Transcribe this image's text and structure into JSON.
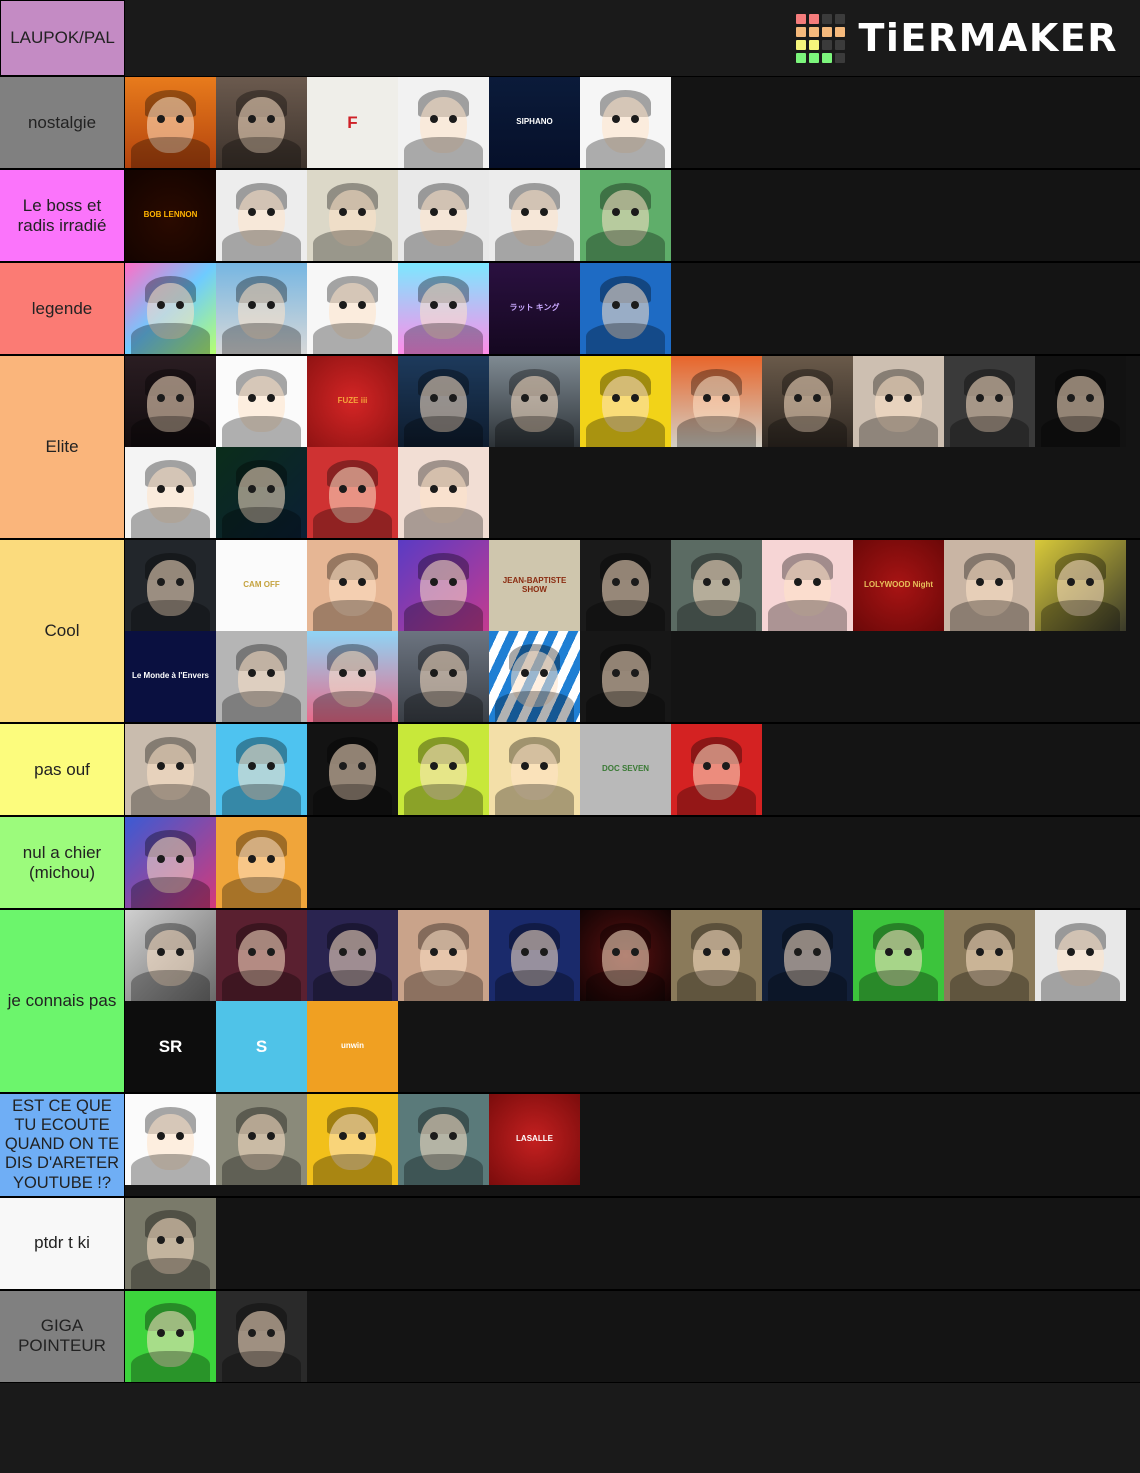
{
  "header": {
    "title": "LAUPOK/PAL",
    "title_color": "#C48BC4",
    "brand": "TiERMAKER",
    "brand_swatches": [
      "#F57C7C",
      "#F57C7C",
      "#3b3b3b",
      "#3b3b3b",
      "#F5B97C",
      "#F5B97C",
      "#F5B97C",
      "#F5B97C",
      "#F5F57C",
      "#F5F57C",
      "#3b3b3b",
      "#3b3b3b",
      "#7CF57C",
      "#7CF57C",
      "#7CF57C",
      "#3b3b3b"
    ]
  },
  "tiers": [
    {
      "label": "nostalgie",
      "color": "#808080",
      "items": [
        {
          "name": "minecraft-duo-animation",
          "text": "",
          "bg": "linear-gradient(180deg,#e87b1c,#b3430d)",
          "fg": "#fff"
        },
        {
          "name": "curly-hair-youtuber",
          "text": "",
          "bg": "linear-gradient(180deg,#6b5a4e,#3d332c)",
          "fg": "#fff"
        },
        {
          "name": "red-black-f-logo",
          "text": "F",
          "bg": "#efeee9",
          "fg": "#cf2027",
          "size": "big"
        },
        {
          "name": "shocked-youtuber-hands-head",
          "text": "",
          "bg": "#f2f2f2",
          "fg": "#111"
        },
        {
          "name": "siphano-logo",
          "text": "SIPHANO",
          "bg": "linear-gradient(180deg,#0b1b3a,#06102a)",
          "fg": "#ffffff",
          "size": "tiny"
        },
        {
          "name": "green-shirt-youtuber",
          "text": "",
          "bg": "#f6f6f6",
          "fg": "#111"
        }
      ]
    },
    {
      "label": "Le boss et radis irradié",
      "color": "#FB74FB",
      "items": [
        {
          "name": "bob-lennon-logo",
          "text": "BOB LENNON",
          "bg": "radial-gradient(circle at 50% 55%,#2a0a00,#120300)",
          "fg": "#ffb300",
          "size": "tiny"
        },
        {
          "name": "surprised-man-grey-jacket",
          "text": "",
          "bg": "#ededed",
          "fg": "#111"
        },
        {
          "name": "bearded-man-yellow-shirt",
          "text": "",
          "bg": "#dcd8c8",
          "fg": "#111"
        },
        {
          "name": "man-with-glasses-beard",
          "text": "",
          "bg": "#e9e9e9",
          "fg": "#111"
        },
        {
          "name": "two-friends-red-shirts",
          "text": "",
          "bg": "#ececec",
          "fg": "#111"
        },
        {
          "name": "cat-cartoon-green-bg",
          "text": "",
          "bg": "#5fae6a",
          "fg": "#fff"
        }
      ]
    },
    {
      "label": "legende",
      "color": "#FB7B74",
      "items": [
        {
          "name": "white-egg-character-rainbow",
          "text": "",
          "bg": "linear-gradient(135deg,#ff6ec7,#6ecbff,#b6ff6e)",
          "fg": "#222"
        },
        {
          "name": "blond-man-striped-shirt",
          "text": "",
          "bg": "linear-gradient(180deg,#76b6e2,#d8d8d8)",
          "fg": "#111"
        },
        {
          "name": "anime-straw-hat-character",
          "text": "",
          "bg": "#f7f7f7",
          "fg": "#111"
        },
        {
          "name": "potato-character",
          "text": "",
          "bg": "linear-gradient(180deg,#7ce8ff,#ff8ce8)",
          "fg": "#6b4a2a"
        },
        {
          "name": "rat-king-purple-avatar",
          "text": "ラット キング",
          "bg": "linear-gradient(180deg,#2a1040,#150820)",
          "fg": "#c9a8ff",
          "size": "tiny"
        },
        {
          "name": "banana-blue-bg",
          "text": "",
          "bg": "#1e6bc4",
          "fg": "#f5d742"
        }
      ]
    },
    {
      "label": "Elite",
      "color": "#FAB57B",
      "items": [
        {
          "name": "man-dark-stage",
          "text": "",
          "bg": "linear-gradient(180deg,#2a1d22,#120c0e)",
          "fg": "#fff"
        },
        {
          "name": "laser-eyes-man",
          "text": "",
          "bg": "#fbfbfb",
          "fg": "#111"
        },
        {
          "name": "fuze-iii-logo",
          "text": "FUZE iii",
          "bg": "radial-gradient(circle,#d42525,#8f1313)",
          "fg": "#f4a23a",
          "size": "tiny"
        },
        {
          "name": "beanie-man-blue-light",
          "text": "",
          "bg": "linear-gradient(180deg,#1d3a5c,#0e1c2e)",
          "fg": "#fff"
        },
        {
          "name": "man-looking-down-grey",
          "text": "",
          "bg": "linear-gradient(180deg,#7f8a92,#2d3338)",
          "fg": "#fff"
        },
        {
          "name": "yellow-stencil-portrait",
          "text": "",
          "bg": "#f2d318",
          "fg": "#111"
        },
        {
          "name": "cap-sunglasses-explosion",
          "text": "",
          "bg": "linear-gradient(180deg,#e8652a,#d3d0c6)",
          "fg": "#111"
        },
        {
          "name": "purple-sunglasses-man",
          "text": "",
          "bg": "linear-gradient(180deg,#6a5a4a,#2f2822)",
          "fg": "#fff"
        },
        {
          "name": "facepalm-man",
          "text": "",
          "bg": "#cdbfb1",
          "fg": "#111"
        },
        {
          "name": "pink-cartoon-head",
          "text": "",
          "bg": "#3a3a3a",
          "fg": "#e79bb0"
        },
        {
          "name": "bearded-man-dark-portrait",
          "text": "",
          "bg": "#121212",
          "fg": "#fff"
        },
        {
          "name": "monkey-cap-cartoon",
          "text": "",
          "bg": "#f4f4f4",
          "fg": "#111"
        },
        {
          "name": "green-neon-hoodie-man",
          "text": "",
          "bg": "linear-gradient(135deg,#0b2d1a,#0b1f35)",
          "fg": "#3cf07a"
        },
        {
          "name": "red-blue-pop-art-portrait",
          "text": "",
          "bg": "#cf3232",
          "fg": "#f0dcb0"
        },
        {
          "name": "big-eyes-cartoon-face",
          "text": "",
          "bg": "#f2ded4",
          "fg": "#111"
        }
      ]
    },
    {
      "label": "Cool",
      "color": "#FBDB7D",
      "items": [
        {
          "name": "yellow-white-arrow-logo",
          "text": "",
          "bg": "#22262b",
          "fg": "#f2a516"
        },
        {
          "name": "cam-off-logo",
          "text": "CAM OFF",
          "bg": "#fbfbfb",
          "fg": "#c5a33f",
          "size": "tiny"
        },
        {
          "name": "mustache-cartoon-face",
          "text": "",
          "bg": "#e6b694",
          "fg": "#6b3a18"
        },
        {
          "name": "young-man-purple-gradient",
          "text": "",
          "bg": "linear-gradient(135deg,#5a3bc4,#c43b8f)",
          "fg": "#fff"
        },
        {
          "name": "jean-baptiste-show-sign",
          "text": "JEAN-BAPTISTE SHOW",
          "bg": "#cfc6ad",
          "fg": "#8a2b10",
          "size": "tiny"
        },
        {
          "name": "jojo-style-portrait",
          "text": "",
          "bg": "#1a1a1a",
          "fg": "#d9c27a"
        },
        {
          "name": "bearded-man-blue-cap",
          "text": "",
          "bg": "#5b6b63",
          "fg": "#fff"
        },
        {
          "name": "girl-cartoon-pink-bg",
          "text": "",
          "bg": "#f6d5d5",
          "fg": "#6b4a3a"
        },
        {
          "name": "lolywood-night-logo",
          "text": "LOLYWOOD Night",
          "bg": "radial-gradient(circle,#a81414,#6b0808)",
          "fg": "#e8c05a",
          "size": "tiny"
        },
        {
          "name": "man-holding-plush-heart",
          "text": "",
          "bg": "#c9b5a4",
          "fg": "#111"
        },
        {
          "name": "yellow-duotone-portrait",
          "text": "",
          "bg": "linear-gradient(135deg,#d8c93a,#3a3a2a)",
          "fg": "#fff"
        },
        {
          "name": "le-monde-a-lenvers-logo",
          "text": "Le Monde à l'Envers",
          "bg": "#0a1040",
          "fg": "#ffffff",
          "size": "tiny"
        },
        {
          "name": "minecraft-hopper-icon",
          "text": "",
          "bg": "#b5b5b5",
          "fg": "#2a3b4a"
        },
        {
          "name": "anime-pink-hair-peace-sign",
          "text": "",
          "bg": "linear-gradient(180deg,#8fd4f5,#e86b8a)",
          "fg": "#fff"
        },
        {
          "name": "young-man-grey-bg",
          "text": "",
          "bg": "linear-gradient(180deg,#6c7480,#3a3f46)",
          "fg": "#fff"
        },
        {
          "name": "smiling-cartoon-blue-rays",
          "text": "",
          "bg": "repeating-linear-gradient(115deg,#1f7fd4 0 9px,#ffffff 9px 18px)",
          "fg": "#111"
        },
        {
          "name": "man-sunglasses-on-head",
          "text": "",
          "bg": "#171717",
          "fg": "#fff"
        }
      ]
    },
    {
      "label": "pas ouf",
      "color": "#FCFC7D",
      "items": [
        {
          "name": "bald-man-grey-shirt",
          "text": "",
          "bg": "#c9bcae",
          "fg": "#111"
        },
        {
          "name": "fur-hat-sunglasses-avatar",
          "text": "",
          "bg": "#4ec3f0",
          "fg": "#fff"
        },
        {
          "name": "curly-hair-plaid-shirt-man",
          "text": "",
          "bg": "#131313",
          "fg": "#fff"
        },
        {
          "name": "two-men-green-screen",
          "text": "",
          "bg": "#c8e83a",
          "fg": "#111"
        },
        {
          "name": "woman-green-jacket",
          "text": "",
          "bg": "#f3dfa8",
          "fg": "#111"
        },
        {
          "name": "doc-seven-avatar",
          "text": "DOC SEVEN",
          "bg": "#b9b9b9",
          "fg": "#3a7a35",
          "size": "tiny"
        },
        {
          "name": "red-pixel-cross-logo",
          "text": "",
          "bg": "#d42222",
          "fg": "#c9c9c9"
        }
      ]
    },
    {
      "label": "nul a chier (michou)",
      "color": "#9CFB7C",
      "items": [
        {
          "name": "man-colorful-graffiti-bg",
          "text": "",
          "bg": "linear-gradient(135deg,#3a5bd4,#d43a7a)",
          "fg": "#fff"
        },
        {
          "name": "blond-cartoon-boy-avatar",
          "text": "",
          "bg": "#f0a53a",
          "fg": "#fff"
        }
      ]
    },
    {
      "label": "je connais pas",
      "color": "#6CF56C",
      "items": [
        {
          "name": "bw-man-thumbs-up",
          "text": "",
          "bg": "linear-gradient(135deg,#d0d0d0,#6a6a6a)",
          "fg": "#222"
        },
        {
          "name": "man-rainbow-shirt-studio",
          "text": "",
          "bg": "#5a2030",
          "fg": "#fff"
        },
        {
          "name": "man-with-dog-cartoon",
          "text": "",
          "bg": "#2a2450",
          "fg": "#fff"
        },
        {
          "name": "wide-eyed-close-up-man",
          "text": "",
          "bg": "#c9a38a",
          "fg": "#111"
        },
        {
          "name": "stained-glass-monk",
          "text": "",
          "bg": "#1a2a6b",
          "fg": "#e8c05a"
        },
        {
          "name": "fire-eyes-dark-avatar",
          "text": "",
          "bg": "radial-gradient(circle,#5a1010,#120404)",
          "fg": "#f5a623"
        },
        {
          "name": "gucci-cap-man",
          "text": "",
          "bg": "#8a7a5a",
          "fg": "#111"
        },
        {
          "name": "yellow-hoodie-man-neon",
          "text": "",
          "bg": "#12203a",
          "fg": "#f2c01a"
        },
        {
          "name": "red-cap-man-green-screen",
          "text": "",
          "bg": "#3cc43c",
          "fg": "#111"
        },
        {
          "name": "child-red-jacket",
          "text": "",
          "bg": "#8a7a5a",
          "fg": "#111"
        },
        {
          "name": "red-cap-headphones-avatar",
          "text": "",
          "bg": "#e8e8e8",
          "fg": "#111"
        },
        {
          "name": "sr-logo",
          "text": "SR",
          "bg": "#0d0d0d",
          "fg": "#ffffff",
          "size": "big"
        },
        {
          "name": "blue-s-logo",
          "text": "S",
          "bg": "#4fc3e8",
          "fg": "#ffffff",
          "size": "big"
        },
        {
          "name": "unwin-logo",
          "text": "unwin",
          "bg": "#f0a022",
          "fg": "#ffffff",
          "size": "tiny"
        }
      ]
    },
    {
      "label": "EST CE QUE TU ECOUTE QUAND ON TE DIS D'ARETER YOUTUBE !?",
      "color": "#6FAEF5",
      "items": [
        {
          "name": "yellow-ticket-phone-logo",
          "text": "",
          "bg": "#fbfbfb",
          "fg": "#f2c01a"
        },
        {
          "name": "man-beanie-outdoors",
          "text": "",
          "bg": "#8a8a7a",
          "fg": "#111"
        },
        {
          "name": "laughing-man-yellow-bg",
          "text": "",
          "bg": "#f2c01a",
          "fg": "#111"
        },
        {
          "name": "shirtless-muscular-man",
          "text": "",
          "bg": "#5a7a7a",
          "fg": "#111"
        },
        {
          "name": "lasalle-logo",
          "text": "LASALLE",
          "bg": "radial-gradient(circle,#c42020,#7a0c0c)",
          "fg": "#ffffff",
          "size": "tiny"
        }
      ]
    },
    {
      "label": "ptdr t ki",
      "color": "#F8F8F8",
      "items": [
        {
          "name": "man-with-face-mask",
          "text": "",
          "bg": "#7a7a6a",
          "fg": "#111"
        }
      ]
    },
    {
      "label": "GIGA POINTEUR",
      "color": "#808080",
      "items": [
        {
          "name": "face-tattoo-man-green-bg",
          "text": "",
          "bg": "#3cd43c",
          "fg": "#111"
        },
        {
          "name": "man-black-hoodie-dark",
          "text": "",
          "bg": "#2a2a2a",
          "fg": "#fff"
        }
      ]
    }
  ]
}
